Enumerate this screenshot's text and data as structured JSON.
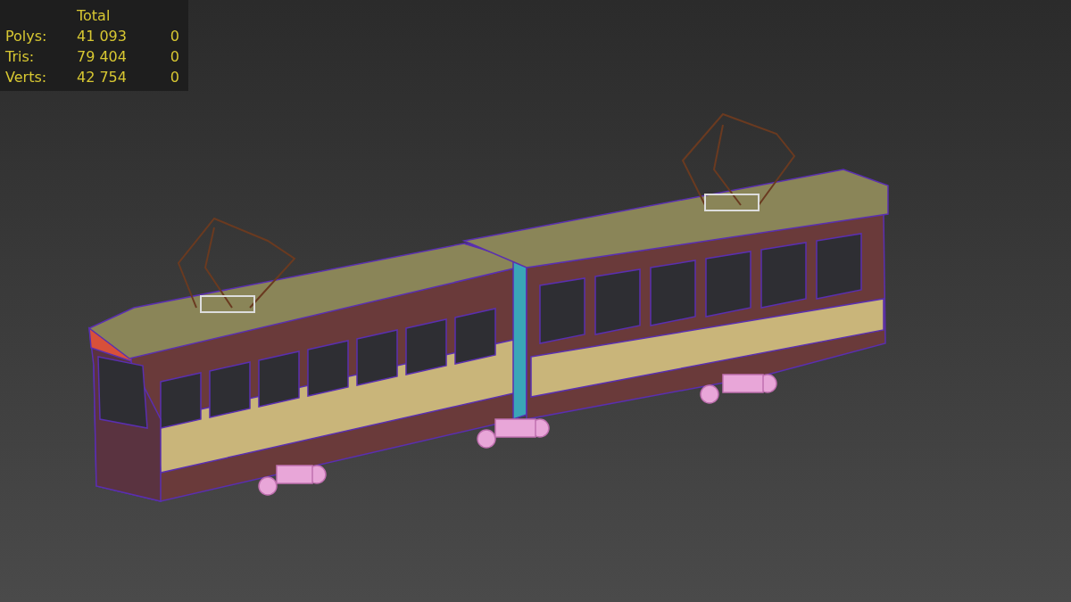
{
  "stats": {
    "heading": "Total",
    "rows": [
      {
        "label": "Polys:",
        "total": "41 093",
        "selected": "0"
      },
      {
        "label": "Tris:",
        "total": "79 404",
        "selected": "0"
      },
      {
        "label": "Verts:",
        "total": "42 754",
        "selected": "0"
      }
    ]
  }
}
